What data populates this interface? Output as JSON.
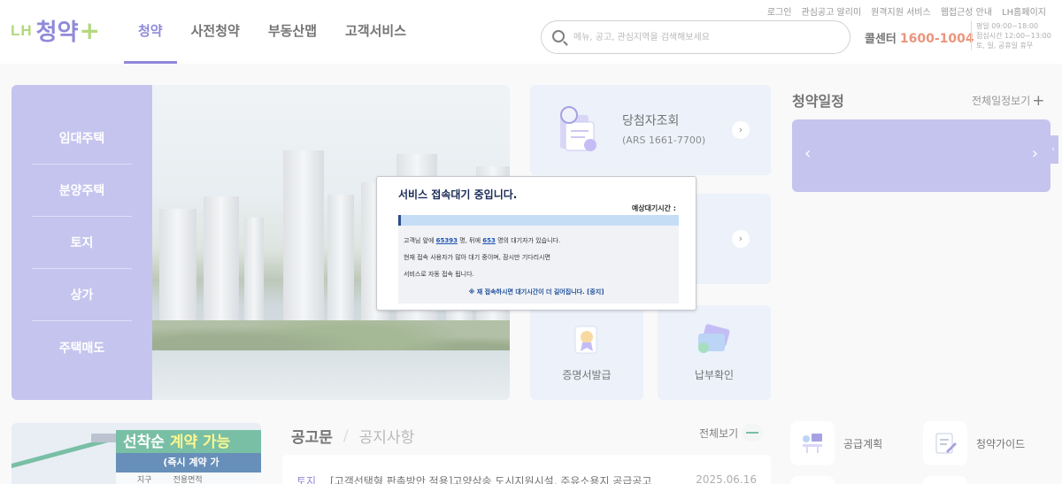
{
  "header": {
    "logo": {
      "prefix": "LH",
      "name": "청약",
      "suffix": "+"
    },
    "util_links": [
      "로그인",
      "관심공고 알리미",
      "원격지원 서비스",
      "웹접근성 안내",
      "LH홈페이지"
    ],
    "nav": [
      {
        "label": "청약",
        "active": true
      },
      {
        "label": "사전청약",
        "active": false
      },
      {
        "label": "부동산맵",
        "active": false
      },
      {
        "label": "고객서비스",
        "active": false
      }
    ],
    "search": {
      "placeholder": "메뉴, 공고, 관심지역을 검색해보세요",
      "value": ""
    },
    "callcenter": {
      "label": "콜센터",
      "number": "1600-1004"
    },
    "hours": [
      "평일 09:00~18:00",
      "점심시간 12:00~13:00",
      "토, 일, 공휴일 휴무"
    ]
  },
  "left_menu": [
    "임대주택",
    "분양주택",
    "토지",
    "상가",
    "주택매도"
  ],
  "cards": {
    "winner": {
      "title": "당첨자조회",
      "sub": "(ARS 1661-7700)"
    },
    "cert": {
      "label": "증명서발급"
    },
    "payment": {
      "label": "납부확인"
    }
  },
  "schedule": {
    "title": "청약일정",
    "view_all": "전체일정보기",
    "prev": "‹",
    "next": "›"
  },
  "promo": {
    "head_prefix": "선착순 ",
    "head_highlight": "계약 가능",
    "sub": "(즉시 계약 가",
    "cols": [
      "지구",
      "전용면적"
    ]
  },
  "notice": {
    "tab_active": "공고문",
    "tab_inactive": "공지사항",
    "view_all": "전체보기",
    "row": {
      "category": "토지",
      "title": "[고객선택형 판촉방안 적용]고양삼송 도시지원시설, 주유소용지 공급공고",
      "date": "2025.06.16"
    }
  },
  "quick": [
    {
      "label": "공급계획"
    },
    {
      "label": "청약가이드"
    }
  ],
  "modal": {
    "title": "서비스 접속대기 중입니다.",
    "eta_label": "예상대기시간 : ",
    "eta_value": "",
    "progress": 0.01,
    "line1_prefix": "고객님 앞에 ",
    "ahead_count": "65393",
    "line1_mid": " 명, 뒤에 ",
    "behind_count": "653",
    "line1_suffix": " 명의 대기자가 있습니다.",
    "line2": "현재 접속 사용자가 많아 대기 중이며, 잠시만 기다리시면",
    "line3": "서비스로 자동 접속 됩니다.",
    "note": "※ 재 접속하시면 대기시간이 더 길어집니다. [중지]"
  },
  "colors": {
    "brand_purple": "#5b52c8",
    "menu_purple": "#aaa9e6",
    "brand_green": "#8fc640",
    "accent_orange": "#e2623e",
    "card_blue": "#e3ebf8"
  }
}
